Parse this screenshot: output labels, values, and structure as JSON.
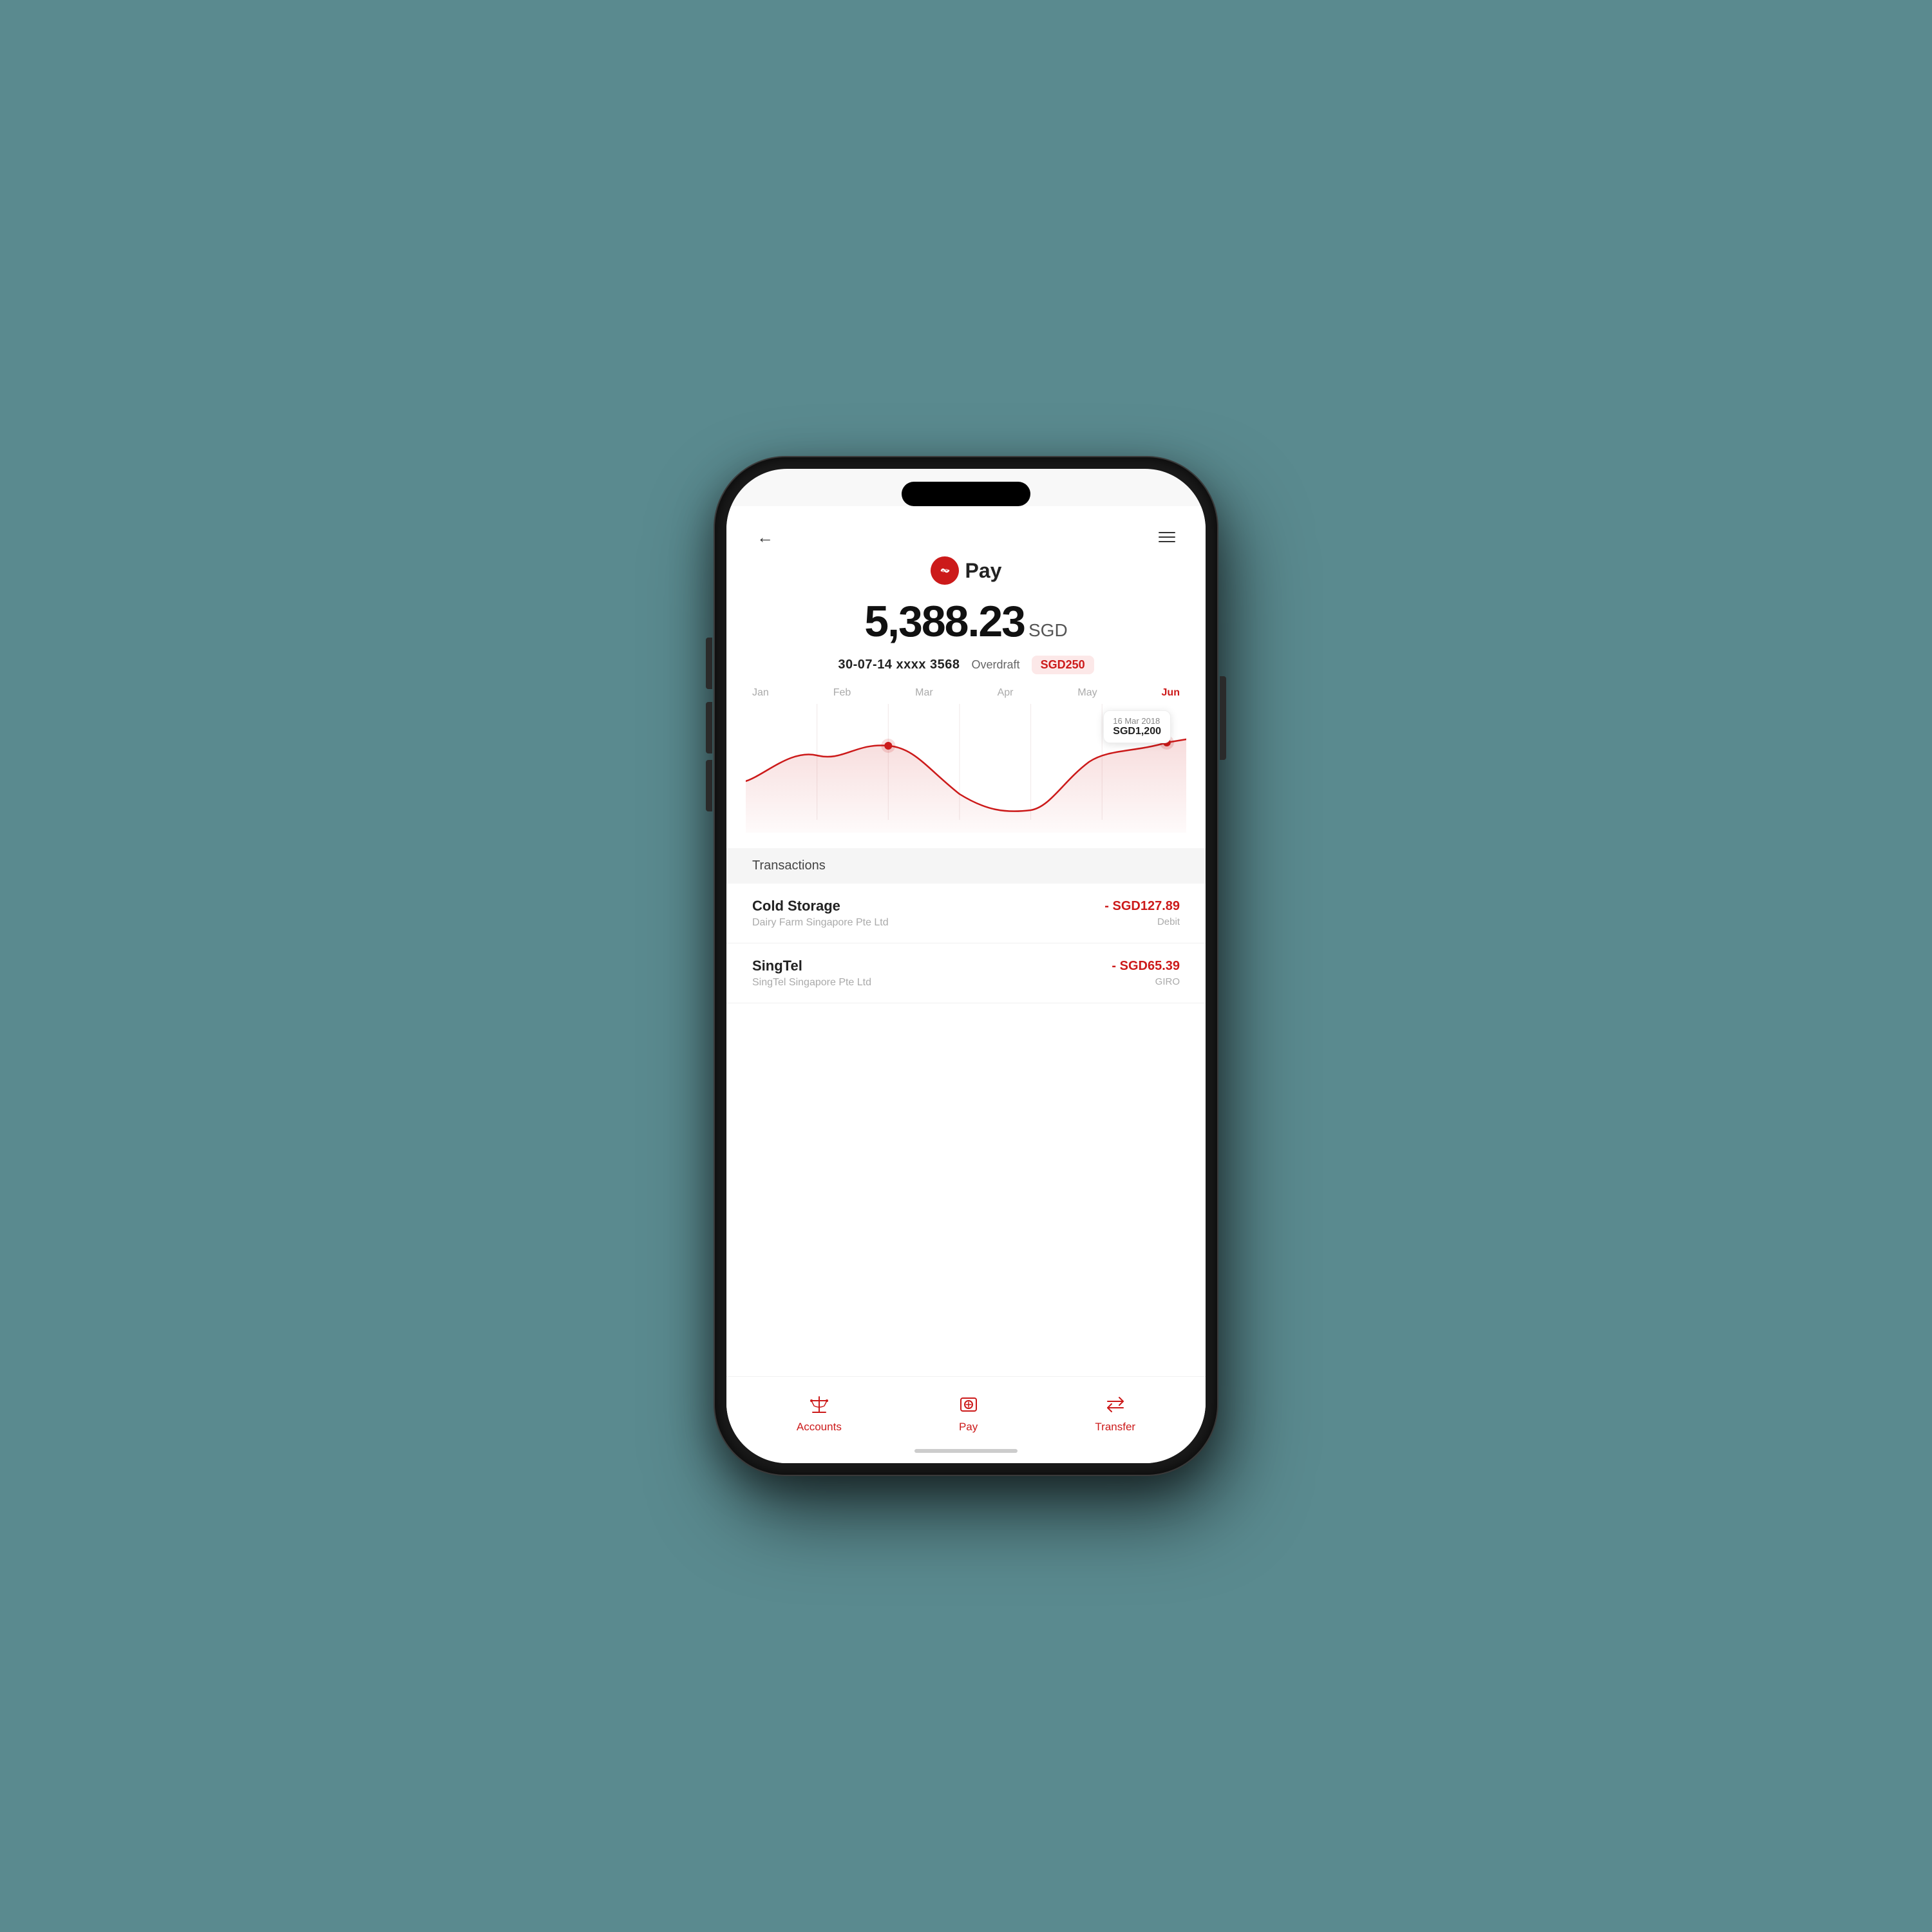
{
  "header": {
    "back_label": "←",
    "menu_label": "≡"
  },
  "logo": {
    "text": "Pay"
  },
  "balance": {
    "amount": "5,388.23",
    "currency": "SGD"
  },
  "account": {
    "number": "30-07-14 xxxx 3568",
    "overdraft_label": "Overdraft",
    "overdraft_amount": "SGD250"
  },
  "chart": {
    "months": [
      "Jan",
      "Feb",
      "Mar",
      "Apr",
      "May",
      "Jun"
    ],
    "active_month": "Jun",
    "tooltip_date": "16 Mar 2018",
    "tooltip_amount": "SGD1,200"
  },
  "transactions": {
    "header": "Transactions",
    "items": [
      {
        "name": "Cold Storage",
        "sub": "Dairy Farm Singapore Pte Ltd",
        "amount": "- SGD127.89",
        "type": "Debit"
      },
      {
        "name": "SingTel",
        "sub": "SingTel Singapore Pte Ltd",
        "amount": "- SGD65.39",
        "type": "GIRO"
      }
    ]
  },
  "bottom_nav": {
    "items": [
      {
        "label": "Accounts",
        "icon": "accounts-icon"
      },
      {
        "label": "Pay",
        "icon": "pay-icon"
      },
      {
        "label": "Transfer",
        "icon": "transfer-icon"
      }
    ]
  }
}
